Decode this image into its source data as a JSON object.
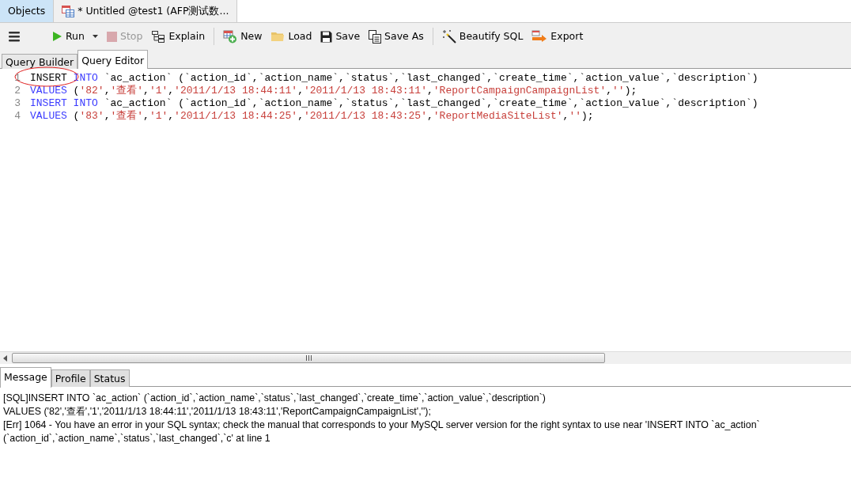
{
  "doc_tabs": [
    {
      "kind": "objects",
      "label": "Objects",
      "selected": false
    },
    {
      "kind": "document",
      "label": "* Untitled @test1 (AFP测试数...",
      "selected": true
    }
  ],
  "toolbar": [
    {
      "kind": "menu"
    },
    {
      "kind": "dropdown",
      "label": "Run",
      "disabled": false
    },
    {
      "kind": "button",
      "label": "Stop",
      "disabled": true
    },
    {
      "kind": "button",
      "label": "Explain",
      "disabled": false
    },
    {
      "kind": "separator"
    },
    {
      "kind": "button",
      "label": "New",
      "disabled": false
    },
    {
      "kind": "button",
      "label": "Load",
      "disabled": false
    },
    {
      "kind": "button",
      "label": "Save",
      "disabled": false
    },
    {
      "kind": "button",
      "label": "Save As",
      "disabled": false
    },
    {
      "kind": "separator"
    },
    {
      "kind": "button",
      "label": "Beautify SQL",
      "disabled": false
    },
    {
      "kind": "button",
      "label": "Export",
      "disabled": false
    }
  ],
  "editor_tabs": [
    {
      "label": "Query Builder",
      "selected": false
    },
    {
      "label": "Query Editor",
      "selected": true
    }
  ],
  "code_lines": [
    {
      "number": "1",
      "tokens": [
        {
          "kind": "plain",
          "text": "INSERT "
        },
        {
          "kind": "keyword",
          "text": "INTO"
        },
        {
          "kind": "plain",
          "text": " `ac_action` (`action_id`,`action_name`,`status`,`last_changed`,`create_time`,`action_value`,`description`)"
        }
      ]
    },
    {
      "number": "2",
      "tokens": [
        {
          "kind": "keyword",
          "text": "VALUES"
        },
        {
          "kind": "plain",
          "text": " ("
        },
        {
          "kind": "string",
          "text": "'82'"
        },
        {
          "kind": "plain",
          "text": ","
        },
        {
          "kind": "string",
          "text": "'查看'"
        },
        {
          "kind": "plain",
          "text": ","
        },
        {
          "kind": "string",
          "text": "'1'"
        },
        {
          "kind": "plain",
          "text": ","
        },
        {
          "kind": "string",
          "text": "'2011/1/13 18:44:11'"
        },
        {
          "kind": "plain",
          "text": ","
        },
        {
          "kind": "string",
          "text": "'2011/1/13 18:43:11'"
        },
        {
          "kind": "plain",
          "text": ","
        },
        {
          "kind": "string",
          "text": "'ReportCampaignCampaignList'"
        },
        {
          "kind": "plain",
          "text": ","
        },
        {
          "kind": "string",
          "text": "''"
        },
        {
          "kind": "plain",
          "text": ");"
        }
      ]
    },
    {
      "number": "3",
      "tokens": [
        {
          "kind": "keyword",
          "text": "INSERT INTO"
        },
        {
          "kind": "plain",
          "text": " `ac_action` (`action_id`,`action_name`,`status`,`last_changed`,`create_time`,`action_value`,`description`)"
        }
      ]
    },
    {
      "number": "4",
      "tokens": [
        {
          "kind": "keyword",
          "text": "VALUES"
        },
        {
          "kind": "plain",
          "text": " ("
        },
        {
          "kind": "string",
          "text": "'83'"
        },
        {
          "kind": "plain",
          "text": ","
        },
        {
          "kind": "string",
          "text": "'查看'"
        },
        {
          "kind": "plain",
          "text": ","
        },
        {
          "kind": "string",
          "text": "'1'"
        },
        {
          "kind": "plain",
          "text": ","
        },
        {
          "kind": "string",
          "text": "'2011/1/13 18:44:25'"
        },
        {
          "kind": "plain",
          "text": ","
        },
        {
          "kind": "string",
          "text": "'2011/1/13 18:43:25'"
        },
        {
          "kind": "plain",
          "text": ","
        },
        {
          "kind": "string",
          "text": "'ReportMediaSiteList'"
        },
        {
          "kind": "plain",
          "text": ","
        },
        {
          "kind": "string",
          "text": "''"
        },
        {
          "kind": "plain",
          "text": ");"
        }
      ]
    }
  ],
  "result_tabs": [
    {
      "label": "Message",
      "selected": true
    },
    {
      "label": "Profile",
      "selected": false
    },
    {
      "label": "Status",
      "selected": false
    }
  ],
  "messages": [
    "[SQL]INSERT INTO `ac_action` (`action_id`,`action_name`,`status`,`last_changed`,`create_time`,`action_value`,`description`)",
    "VALUES ('82','查看','1','2011/1/13 18:44:11','2011/1/13 18:43:11','ReportCampaignCampaignList','');",
    "[Err] 1064 - You have an error in your SQL syntax; check the manual that corresponds to your MySQL server version for the right syntax to use near 'INSERT INTO `ac_action`",
    "(`action_id`,`action_name`,`status`,`last_changed`,`c' at line 1"
  ]
}
